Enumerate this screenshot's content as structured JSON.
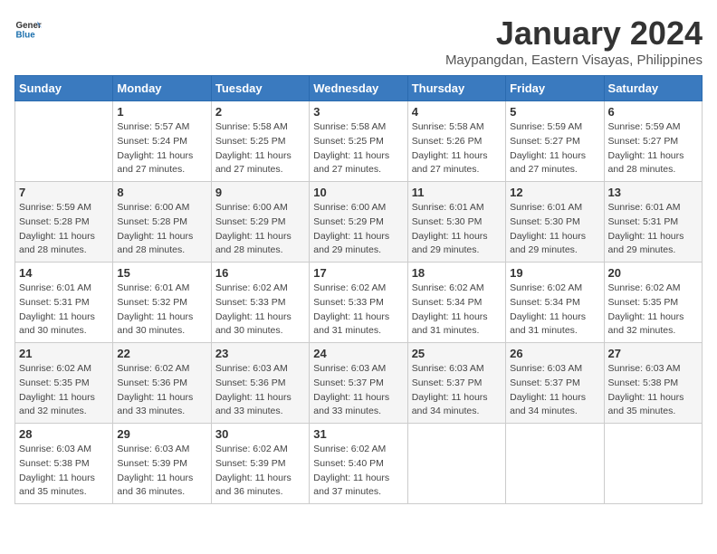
{
  "header": {
    "logo_line1": "General",
    "logo_line2": "Blue",
    "month": "January 2024",
    "location": "Maypangdan, Eastern Visayas, Philippines"
  },
  "weekdays": [
    "Sunday",
    "Monday",
    "Tuesday",
    "Wednesday",
    "Thursday",
    "Friday",
    "Saturday"
  ],
  "weeks": [
    [
      {
        "num": "",
        "sunrise": "",
        "sunset": "",
        "daylight": ""
      },
      {
        "num": "1",
        "sunrise": "Sunrise: 5:57 AM",
        "sunset": "Sunset: 5:24 PM",
        "daylight": "Daylight: 11 hours and 27 minutes."
      },
      {
        "num": "2",
        "sunrise": "Sunrise: 5:58 AM",
        "sunset": "Sunset: 5:25 PM",
        "daylight": "Daylight: 11 hours and 27 minutes."
      },
      {
        "num": "3",
        "sunrise": "Sunrise: 5:58 AM",
        "sunset": "Sunset: 5:25 PM",
        "daylight": "Daylight: 11 hours and 27 minutes."
      },
      {
        "num": "4",
        "sunrise": "Sunrise: 5:58 AM",
        "sunset": "Sunset: 5:26 PM",
        "daylight": "Daylight: 11 hours and 27 minutes."
      },
      {
        "num": "5",
        "sunrise": "Sunrise: 5:59 AM",
        "sunset": "Sunset: 5:27 PM",
        "daylight": "Daylight: 11 hours and 27 minutes."
      },
      {
        "num": "6",
        "sunrise": "Sunrise: 5:59 AM",
        "sunset": "Sunset: 5:27 PM",
        "daylight": "Daylight: 11 hours and 28 minutes."
      }
    ],
    [
      {
        "num": "7",
        "sunrise": "Sunrise: 5:59 AM",
        "sunset": "Sunset: 5:28 PM",
        "daylight": "Daylight: 11 hours and 28 minutes."
      },
      {
        "num": "8",
        "sunrise": "Sunrise: 6:00 AM",
        "sunset": "Sunset: 5:28 PM",
        "daylight": "Daylight: 11 hours and 28 minutes."
      },
      {
        "num": "9",
        "sunrise": "Sunrise: 6:00 AM",
        "sunset": "Sunset: 5:29 PM",
        "daylight": "Daylight: 11 hours and 28 minutes."
      },
      {
        "num": "10",
        "sunrise": "Sunrise: 6:00 AM",
        "sunset": "Sunset: 5:29 PM",
        "daylight": "Daylight: 11 hours and 29 minutes."
      },
      {
        "num": "11",
        "sunrise": "Sunrise: 6:01 AM",
        "sunset": "Sunset: 5:30 PM",
        "daylight": "Daylight: 11 hours and 29 minutes."
      },
      {
        "num": "12",
        "sunrise": "Sunrise: 6:01 AM",
        "sunset": "Sunset: 5:30 PM",
        "daylight": "Daylight: 11 hours and 29 minutes."
      },
      {
        "num": "13",
        "sunrise": "Sunrise: 6:01 AM",
        "sunset": "Sunset: 5:31 PM",
        "daylight": "Daylight: 11 hours and 29 minutes."
      }
    ],
    [
      {
        "num": "14",
        "sunrise": "Sunrise: 6:01 AM",
        "sunset": "Sunset: 5:31 PM",
        "daylight": "Daylight: 11 hours and 30 minutes."
      },
      {
        "num": "15",
        "sunrise": "Sunrise: 6:01 AM",
        "sunset": "Sunset: 5:32 PM",
        "daylight": "Daylight: 11 hours and 30 minutes."
      },
      {
        "num": "16",
        "sunrise": "Sunrise: 6:02 AM",
        "sunset": "Sunset: 5:33 PM",
        "daylight": "Daylight: 11 hours and 30 minutes."
      },
      {
        "num": "17",
        "sunrise": "Sunrise: 6:02 AM",
        "sunset": "Sunset: 5:33 PM",
        "daylight": "Daylight: 11 hours and 31 minutes."
      },
      {
        "num": "18",
        "sunrise": "Sunrise: 6:02 AM",
        "sunset": "Sunset: 5:34 PM",
        "daylight": "Daylight: 11 hours and 31 minutes."
      },
      {
        "num": "19",
        "sunrise": "Sunrise: 6:02 AM",
        "sunset": "Sunset: 5:34 PM",
        "daylight": "Daylight: 11 hours and 31 minutes."
      },
      {
        "num": "20",
        "sunrise": "Sunrise: 6:02 AM",
        "sunset": "Sunset: 5:35 PM",
        "daylight": "Daylight: 11 hours and 32 minutes."
      }
    ],
    [
      {
        "num": "21",
        "sunrise": "Sunrise: 6:02 AM",
        "sunset": "Sunset: 5:35 PM",
        "daylight": "Daylight: 11 hours and 32 minutes."
      },
      {
        "num": "22",
        "sunrise": "Sunrise: 6:02 AM",
        "sunset": "Sunset: 5:36 PM",
        "daylight": "Daylight: 11 hours and 33 minutes."
      },
      {
        "num": "23",
        "sunrise": "Sunrise: 6:03 AM",
        "sunset": "Sunset: 5:36 PM",
        "daylight": "Daylight: 11 hours and 33 minutes."
      },
      {
        "num": "24",
        "sunrise": "Sunrise: 6:03 AM",
        "sunset": "Sunset: 5:37 PM",
        "daylight": "Daylight: 11 hours and 33 minutes."
      },
      {
        "num": "25",
        "sunrise": "Sunrise: 6:03 AM",
        "sunset": "Sunset: 5:37 PM",
        "daylight": "Daylight: 11 hours and 34 minutes."
      },
      {
        "num": "26",
        "sunrise": "Sunrise: 6:03 AM",
        "sunset": "Sunset: 5:37 PM",
        "daylight": "Daylight: 11 hours and 34 minutes."
      },
      {
        "num": "27",
        "sunrise": "Sunrise: 6:03 AM",
        "sunset": "Sunset: 5:38 PM",
        "daylight": "Daylight: 11 hours and 35 minutes."
      }
    ],
    [
      {
        "num": "28",
        "sunrise": "Sunrise: 6:03 AM",
        "sunset": "Sunset: 5:38 PM",
        "daylight": "Daylight: 11 hours and 35 minutes."
      },
      {
        "num": "29",
        "sunrise": "Sunrise: 6:03 AM",
        "sunset": "Sunset: 5:39 PM",
        "daylight": "Daylight: 11 hours and 36 minutes."
      },
      {
        "num": "30",
        "sunrise": "Sunrise: 6:02 AM",
        "sunset": "Sunset: 5:39 PM",
        "daylight": "Daylight: 11 hours and 36 minutes."
      },
      {
        "num": "31",
        "sunrise": "Sunrise: 6:02 AM",
        "sunset": "Sunset: 5:40 PM",
        "daylight": "Daylight: 11 hours and 37 minutes."
      },
      {
        "num": "",
        "sunrise": "",
        "sunset": "",
        "daylight": ""
      },
      {
        "num": "",
        "sunrise": "",
        "sunset": "",
        "daylight": ""
      },
      {
        "num": "",
        "sunrise": "",
        "sunset": "",
        "daylight": ""
      }
    ]
  ]
}
